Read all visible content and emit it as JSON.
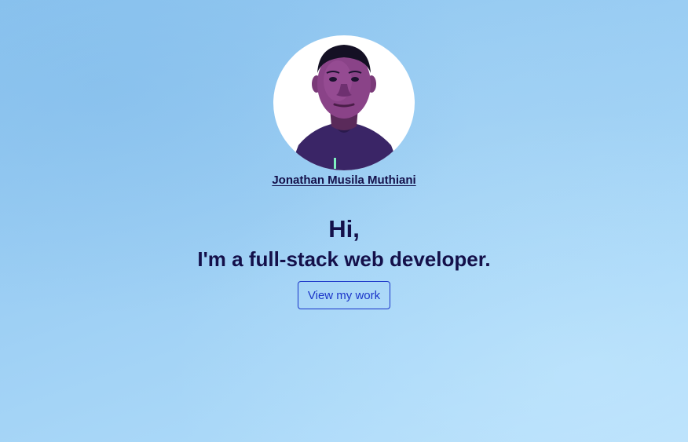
{
  "profile": {
    "name": "Jonathan Musila Muthiani",
    "avatar_icon": "profile-photo"
  },
  "hero": {
    "greeting": "Hi,",
    "tagline": "I'm a full-stack web developer.",
    "cta_label": "View my work"
  },
  "colors": {
    "text": "#14104a",
    "accent": "#1a35c8",
    "background": "#9dcff4"
  }
}
